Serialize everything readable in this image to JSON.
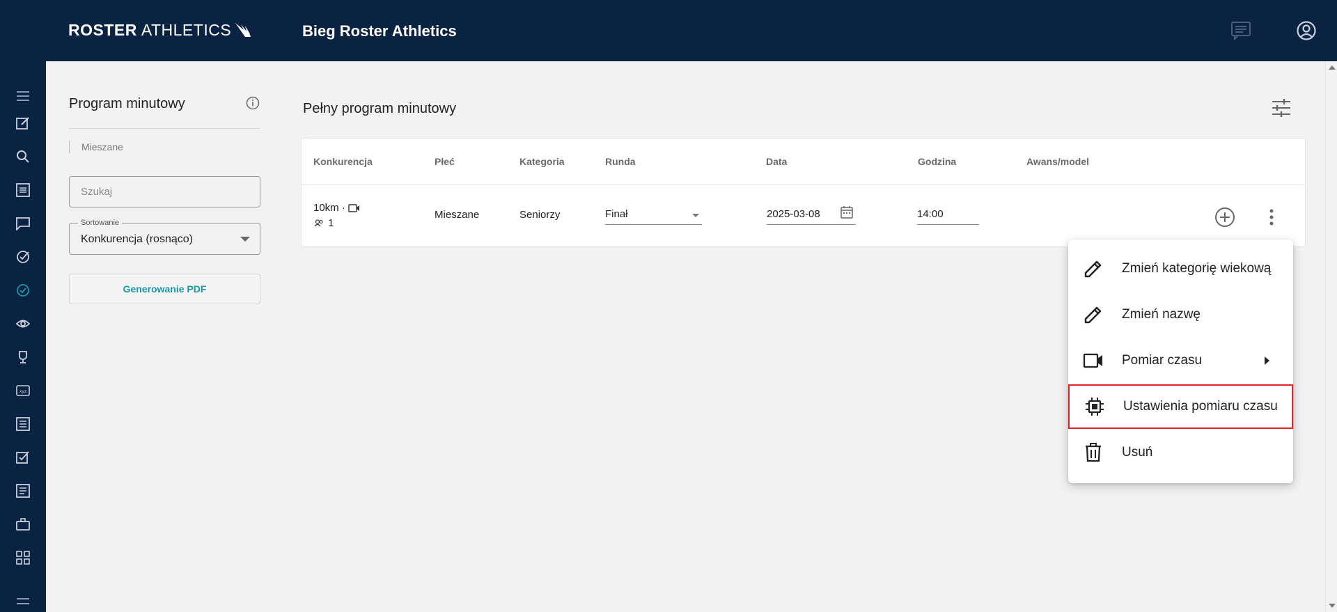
{
  "header": {
    "logo_bold": "ROSTER",
    "logo_light": "ATHLETICS",
    "title": "Bieg Roster Athletics",
    "icons": [
      "chat-icon",
      "account-circle-icon"
    ]
  },
  "sidebar": {
    "items": [
      {
        "icon": "menu-icon"
      },
      {
        "icon": "edit-icon"
      },
      {
        "icon": "search-icon"
      },
      {
        "icon": "list-icon"
      },
      {
        "icon": "comment-icon"
      },
      {
        "icon": "check-circle-icon"
      },
      {
        "icon": "check-circle-active-icon",
        "active": true
      },
      {
        "icon": "eye-icon"
      },
      {
        "icon": "trophy-icon"
      },
      {
        "icon": "xyz-icon"
      },
      {
        "icon": "list-alt-icon"
      },
      {
        "icon": "checkbox-icon"
      },
      {
        "icon": "article-icon"
      },
      {
        "icon": "briefcase-icon"
      },
      {
        "icon": "apps-icon"
      },
      {
        "icon": "menu-bottom-icon"
      }
    ]
  },
  "left_panel": {
    "title": "Program minutowy",
    "filter_tag": "Mieszane",
    "search_placeholder": "Szukaj",
    "sort_label": "Sortowanie",
    "sort_value": "Konkurencja (rosnąco)",
    "pdf_button": "Generowanie PDF"
  },
  "main": {
    "title": "Pełny program minutowy",
    "columns": [
      "Konkurencja",
      "Płeć",
      "Kategoria",
      "Runda",
      "Data",
      "Godzina",
      "Awans/model"
    ],
    "rows": [
      {
        "event": "10km ·",
        "count": "1",
        "gender": "Mieszane",
        "category": "Seniorzy",
        "round": "Finał",
        "date": "2025-03-08",
        "time": "14:00",
        "advance": ""
      }
    ]
  },
  "context_menu": {
    "items": [
      {
        "label": "Zmień kategorię wiekową",
        "icon": "pencil-icon"
      },
      {
        "label": "Zmień nazwę",
        "icon": "pencil-icon"
      },
      {
        "label": "Pomiar czasu",
        "icon": "videocam-icon",
        "has_submenu": true
      },
      {
        "label": "Ustawienia pomiaru czasu",
        "icon": "chip-icon",
        "highlighted": true
      },
      {
        "label": "Usuń",
        "icon": "trash-icon"
      }
    ]
  },
  "colors": {
    "header_bg": "#0b2342",
    "accent": "#1a97a8",
    "highlight_border": "#e2232a",
    "content_bg": "#f2f2f2"
  }
}
